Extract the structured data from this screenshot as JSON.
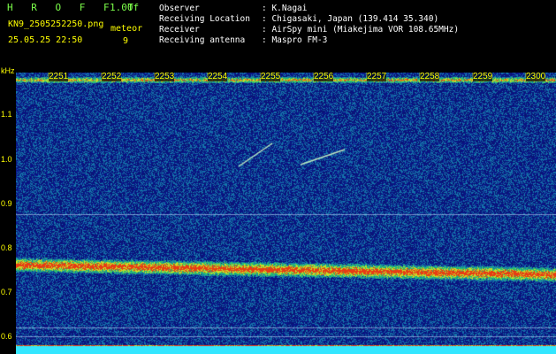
{
  "header": {
    "brand": "H R O F F T",
    "version": "1.00f",
    "filename": "KN9_2505252250.png",
    "datetime": "25.05.25 22:50",
    "meteor_label": "meteor",
    "meteor_count": "9",
    "info_labels": [
      "Observer",
      "Receiving Location",
      "Receiver",
      "Receiving antenna"
    ],
    "info_values": [
      ": K.Nagai",
      ": Chigasaki, Japan (139.414 35.340)",
      ": AirSpy mini (Miakejima VOR 108.65MHz)",
      ": Maspro FM-3"
    ]
  },
  "axis": {
    "unit": "kHz",
    "y_ticks": [
      "1.1",
      "1.0",
      "0.9",
      "0.8",
      "0.7",
      "0.6"
    ],
    "time_ticks": [
      "2251",
      "2252",
      "2253",
      "2254",
      "2255",
      "2256",
      "2257",
      "2258",
      "2259",
      "2300"
    ]
  },
  "colors": {
    "label": "#ffff00",
    "brand": "#7cff4a",
    "text": "#ffffff",
    "background": "#061a7a"
  }
}
